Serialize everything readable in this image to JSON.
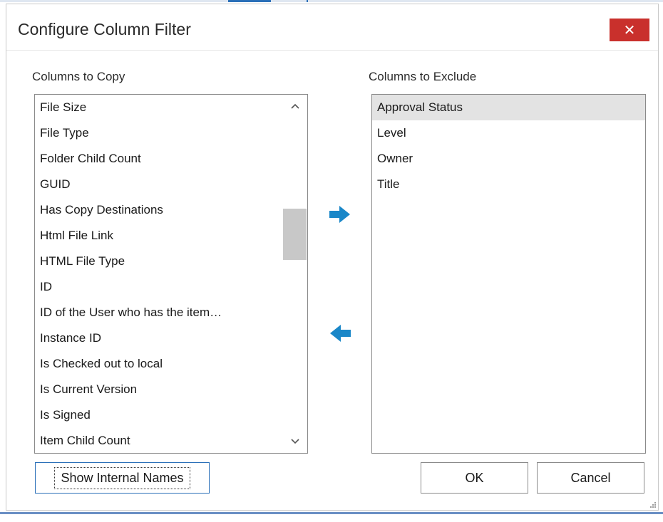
{
  "dialog": {
    "title": "Configure Column Filter",
    "close_label": "✕"
  },
  "left_panel": {
    "label": "Columns to Copy",
    "items": [
      "File Size",
      "File Type",
      "Folder Child Count",
      "GUID",
      "Has Copy Destinations",
      "Html File Link",
      "HTML File Type",
      "ID",
      "ID of the User who has the item…",
      "Instance ID",
      "Is Checked out to local",
      "Is Current Version",
      "Is Signed",
      "Item Child Count"
    ]
  },
  "right_panel": {
    "label": "Columns to Exclude",
    "items": [
      "Approval Status",
      "Level",
      "Owner",
      "Title"
    ],
    "selected_item": "Approval Status"
  },
  "buttons": {
    "show_internal_names": "Show Internal Names",
    "ok": "OK",
    "cancel": "Cancel"
  },
  "icons": {
    "move_right": "arrow-right-icon",
    "move_left": "arrow-left-icon"
  },
  "colors": {
    "accent": "#1a87c8",
    "close_bg": "#c9302c",
    "selection": "#e3e3e3"
  }
}
